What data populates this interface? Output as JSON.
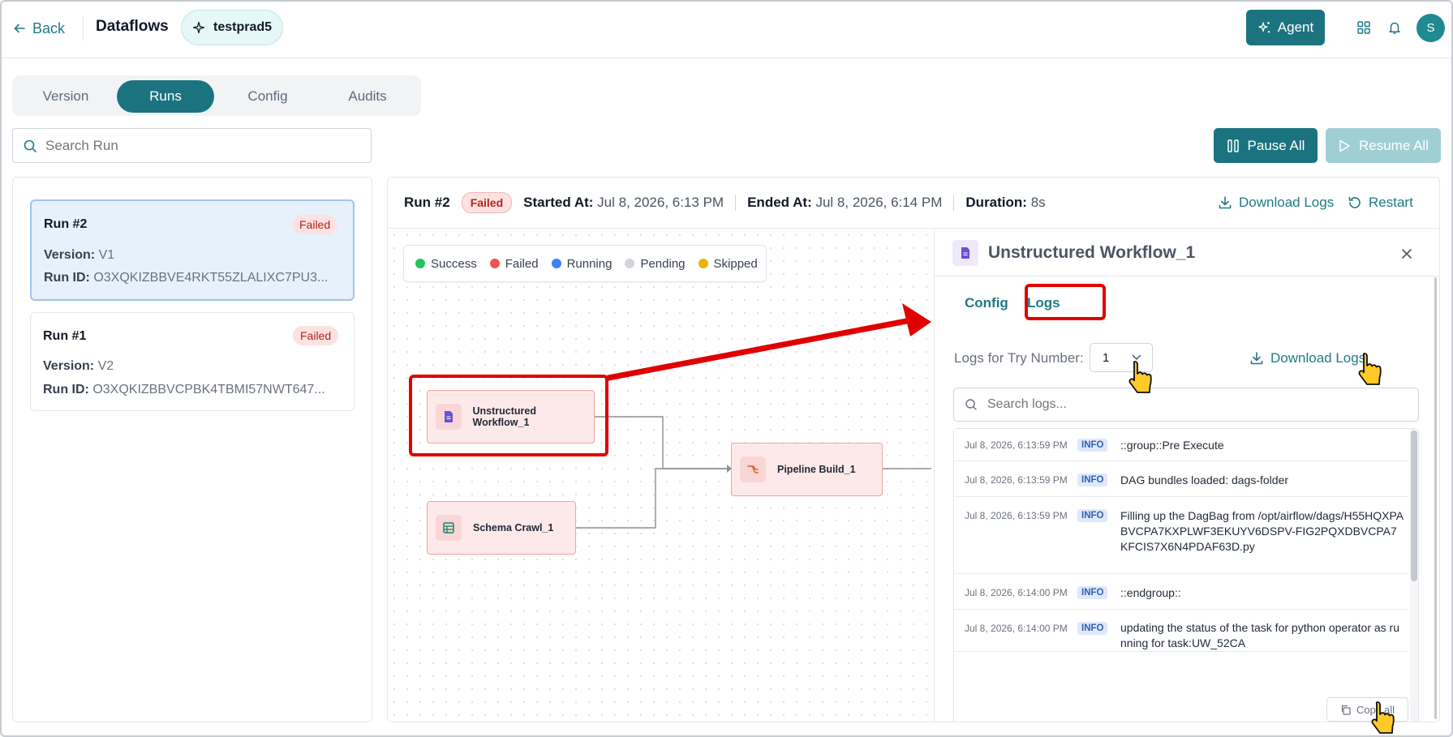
{
  "header": {
    "back_label": "Back",
    "title": "Dataflows",
    "pipeline_name": "testprad5",
    "agent_label": "Agent",
    "avatar_initial": "S"
  },
  "tabs": [
    {
      "label": "Version",
      "active": false
    },
    {
      "label": "Runs",
      "active": true
    },
    {
      "label": "Config",
      "active": false
    },
    {
      "label": "Audits",
      "active": false
    }
  ],
  "search": {
    "placeholder": "Search Run"
  },
  "actions": {
    "pause_label": "Pause All",
    "resume_label": "Resume All"
  },
  "runs": [
    {
      "title": "Run #2",
      "status": "Failed",
      "version_label": "Version:",
      "version": "V1",
      "runid_label": "Run ID:",
      "run_id": "O3XQKIZBBVE4RKT55ZLALIXC7PU3..."
    },
    {
      "title": "Run #1",
      "status": "Failed",
      "version_label": "Version:",
      "version": "V2",
      "runid_label": "Run ID:",
      "run_id": "O3XQKIZBBVCPBK4TBMI57NWT647..."
    }
  ],
  "run_header": {
    "run": "Run #2",
    "status": "Failed",
    "started_label": "Started At:",
    "started": "Jul 8, 2026, 6:13 PM",
    "ended_label": "Ended At:",
    "ended": "Jul 8, 2026, 6:14 PM",
    "duration_label": "Duration:",
    "duration": "8s",
    "download_label": "Download Logs",
    "restart_label": "Restart"
  },
  "legend": [
    {
      "label": "Success",
      "color": "#22c55e"
    },
    {
      "label": "Failed",
      "color": "#f05252"
    },
    {
      "label": "Running",
      "color": "#3b82f6"
    },
    {
      "label": "Pending",
      "color": "#d1d5db"
    },
    {
      "label": "Skipped",
      "color": "#eab308"
    }
  ],
  "nodes": {
    "unstructured": "Unstructured Workflow_1",
    "schema": "Schema Crawl_1",
    "pipeline": "Pipeline Build_1"
  },
  "side_panel": {
    "title": "Unstructured Workflow_1",
    "tab_config": "Config",
    "tab_logs": "Logs",
    "try_label": "Logs for Try Number:",
    "try_value": "1",
    "download_label": "Download Logs",
    "search_placeholder": "Search logs...",
    "copy_label": "Copy all",
    "logs": [
      {
        "time": "Jul 8, 2026, 6:13:59 PM",
        "level": "INFO",
        "message": "::group::Pre Execute"
      },
      {
        "time": "Jul 8, 2026, 6:13:59 PM",
        "level": "INFO",
        "message": "DAG bundles loaded: dags-folder"
      },
      {
        "time": "Jul 8, 2026, 6:13:59 PM",
        "level": "INFO",
        "message": "Filling up the DagBag from /opt/airflow/dags/H55HQXPABVCPA7KXPLWF3EKUYV6DSPV-FIG2PQXDBVCPA7KFCIS7X6N4PDAF63D.py"
      },
      {
        "time": "Jul 8, 2026, 6:14:00 PM",
        "level": "INFO",
        "message": "::endgroup::"
      },
      {
        "time": "Jul 8, 2026, 6:14:00 PM",
        "level": "INFO",
        "message": "updating the status of the task for python operator as running for task:UW_52CA"
      }
    ]
  }
}
